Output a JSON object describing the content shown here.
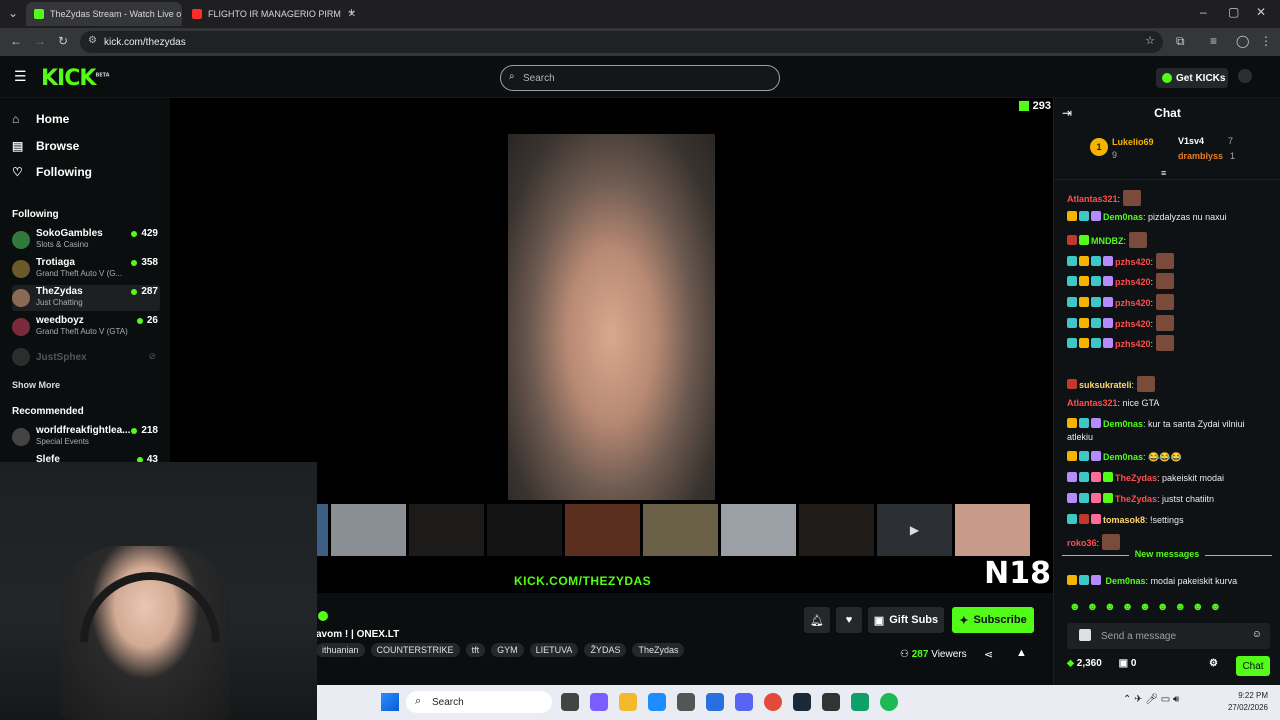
{
  "browser": {
    "tabs": [
      {
        "label": "TheZydas Stream - Watch Live o",
        "active": true
      },
      {
        "label": "FLIGHTO IR MANAGERIO PIRM",
        "active": false
      }
    ],
    "url": "kick.com/thezydas"
  },
  "header": {
    "logo": "KICK",
    "beta": "BETA",
    "search_placeholder": "Search",
    "get_kicks": "Get KICKs"
  },
  "sidebar": {
    "nav": [
      {
        "label": "Home",
        "icon": "home-icon"
      },
      {
        "label": "Browse",
        "icon": "browse-icon"
      },
      {
        "label": "Following",
        "icon": "heart-icon"
      }
    ],
    "following_title": "Following",
    "following": [
      {
        "name": "SokoGambles",
        "category": "Slots & Casino",
        "viewers": "429"
      },
      {
        "name": "Trotiaga",
        "category": "Grand Theft Auto V (G...",
        "viewers": "358"
      },
      {
        "name": "TheZydas",
        "category": "Just Chatting",
        "viewers": "287"
      },
      {
        "name": "weedboyz",
        "category": "Grand Theft Auto V (GTA)",
        "viewers": "26"
      },
      {
        "name": "JustSphex",
        "category": "",
        "viewers": ""
      }
    ],
    "show_more": "Show More",
    "recommended_title": "Recommended",
    "recommended": [
      {
        "name": "worldfreakfightlea...",
        "category": "Special Events",
        "viewers": "218"
      },
      {
        "name": "Slefe",
        "category": "",
        "viewers": "43"
      }
    ]
  },
  "stream": {
    "viewer_count_top": "293",
    "watermark": "KICK.COM/THEZYDAS",
    "rating": "N18",
    "title": "avom ! | ONEX.LT",
    "tags": [
      "ithuanian",
      "COUNTERSTRIKE",
      "tft",
      "GYM",
      "LIETUVA",
      "ŽYDAS",
      "TheZydas"
    ],
    "gift_subs": "Gift Subs",
    "subscribe": "Subscribe",
    "viewers_count": "287",
    "viewers_label": "Viewers"
  },
  "chat": {
    "title": "Chat",
    "leaderboard": [
      {
        "name": "Lukelio69",
        "value": "9"
      },
      {
        "name": "V1sv4",
        "value": "7"
      },
      {
        "name": "dramblyss",
        "value": "1"
      }
    ],
    "messages": [
      {
        "user": "Atlantas321",
        "text": "",
        "color": "#ff4d4d",
        "emotes": 1
      },
      {
        "user": "Dem0nas",
        "text": "pizdalyzas nu naxui",
        "color": "#53fc18",
        "emotes": 0
      },
      {
        "user": "MNDBZ",
        "text": "",
        "color": "#53fc18",
        "emotes": 1
      },
      {
        "user": "pzhs420",
        "text": "",
        "color": "#ff4d4d",
        "emotes": 1
      },
      {
        "user": "pzhs420",
        "text": "",
        "color": "#ff4d4d",
        "emotes": 1
      },
      {
        "user": "pzhs420",
        "text": "",
        "color": "#ff4d4d",
        "emotes": 1
      },
      {
        "user": "pzhs420",
        "text": "",
        "color": "#ff4d4d",
        "emotes": 1
      },
      {
        "user": "pzhs420",
        "text": "",
        "color": "#ff4d4d",
        "emotes": 1
      },
      {
        "user": "suksukrateli",
        "text": "",
        "color": "#ffd66b",
        "emotes": 1
      },
      {
        "user": "Atlantas321",
        "text": "nice GTA",
        "color": "#ff4d4d",
        "emotes": 0
      },
      {
        "user": "Dem0nas",
        "text": "kur ta santa Zydai vilniui atlekiu",
        "color": "#53fc18",
        "emotes": 0
      },
      {
        "user": "Dem0nas",
        "text": "😂😂😂",
        "color": "#53fc18",
        "emotes": 0
      },
      {
        "user": "TheZydas",
        "text": "pakeiskit modai",
        "color": "#ff4d4d",
        "emotes": 0
      },
      {
        "user": "TheZydas",
        "text": "justst chatiitn",
        "color": "#ff4d4d",
        "emotes": 0
      },
      {
        "user": "tomasok8",
        "text": "!settings",
        "color": "#ffd66b",
        "emotes": 0
      },
      {
        "user": "roko36",
        "text": "",
        "color": "#ff4d4d",
        "emotes": 1
      }
    ],
    "new_messages": "New messages",
    "last_message": {
      "user": "Dem0nas",
      "text": "modai pakeiskit kurva",
      "color": "#53fc18"
    },
    "send_placeholder": "Send a message",
    "points": "2,360",
    "gifts": "0",
    "chat_button": "Chat"
  },
  "taskbar": {
    "search": "Search",
    "time": "9:22 PM",
    "date": "27/02/2026"
  },
  "colors": {
    "brand": "#53fc18",
    "background": "#0b0e0f",
    "chat_bg": "#0f1214"
  }
}
